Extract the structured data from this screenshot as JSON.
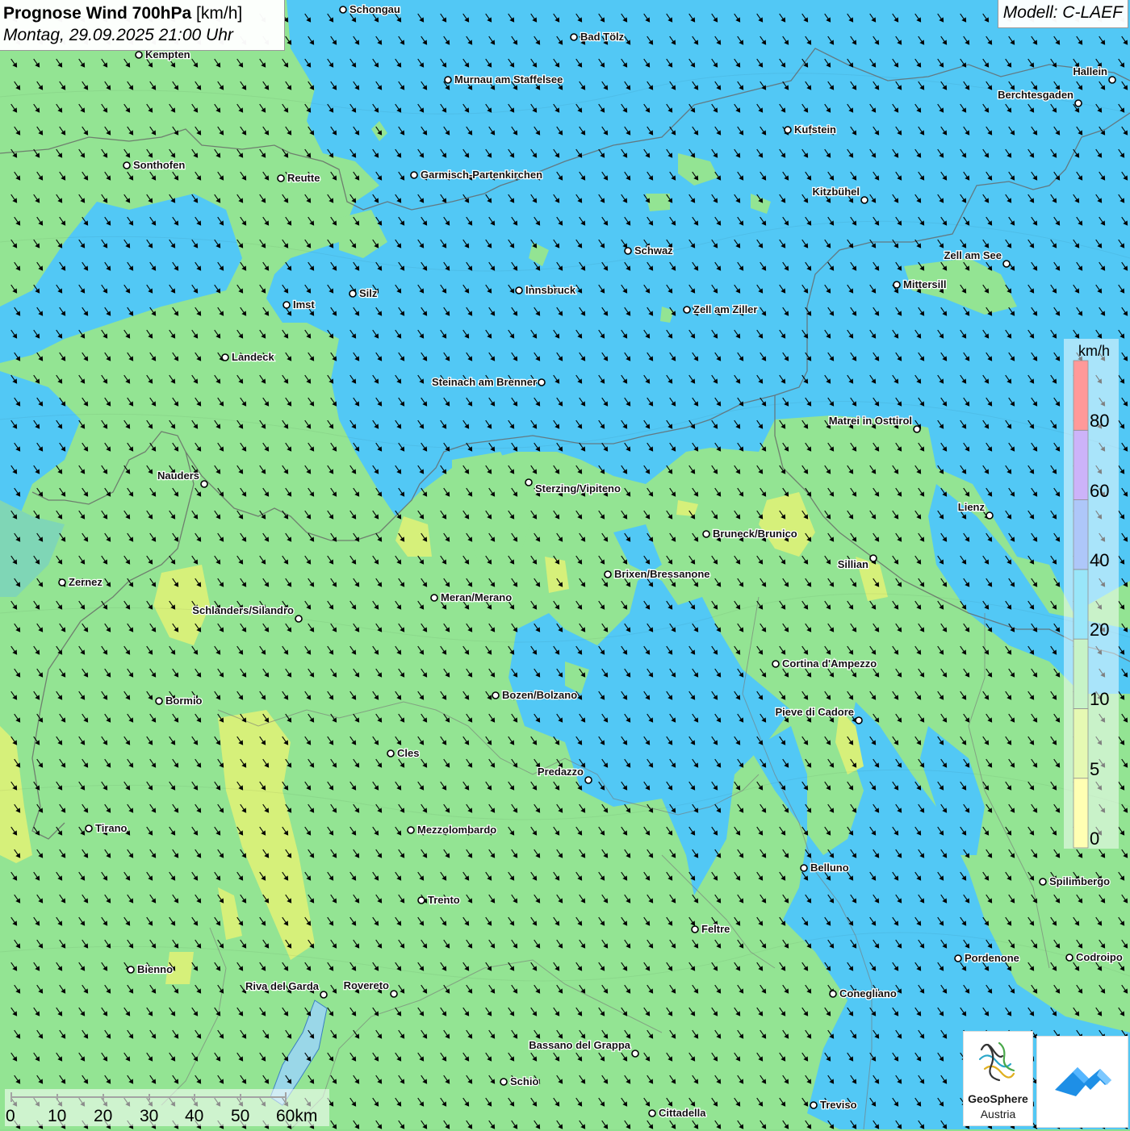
{
  "header": {
    "title_bold": "Prognose Wind 700hPa",
    "title_unit": "[km/h]",
    "datetime": "Montag, 29.09.2025 21:00 Uhr",
    "model": "Modell: C-LAEF"
  },
  "legend": {
    "unit": "km/h",
    "bins": [
      {
        "label": "0",
        "color": "#ffff66"
      },
      {
        "label": "5",
        "color": "#ccf266"
      },
      {
        "label": "10",
        "color": "#8fe68f"
      },
      {
        "label": "20",
        "color": "#33ccf2"
      },
      {
        "label": "40",
        "color": "#5c8ff2"
      },
      {
        "label": "60",
        "color": "#9966f2"
      },
      {
        "label": "80",
        "color": "#ff3333"
      }
    ]
  },
  "scale_bar": {
    "labels": [
      "0",
      "10",
      "20",
      "30",
      "40",
      "50",
      "60km"
    ]
  },
  "cities": [
    {
      "name": "Schongau"
    },
    {
      "name": "Kempten"
    },
    {
      "name": "Bad Tölz"
    },
    {
      "name": "Murnau am Staffelsee"
    },
    {
      "name": "Hallein"
    },
    {
      "name": "Berchtesgaden"
    },
    {
      "name": "Kufstein"
    },
    {
      "name": "Sonthofen"
    },
    {
      "name": "Reutte"
    },
    {
      "name": "Garmisch-Partenkirchen"
    },
    {
      "name": "Kitzbühel"
    },
    {
      "name": "Schwaz"
    },
    {
      "name": "Zell am See"
    },
    {
      "name": "Mittersill"
    },
    {
      "name": "Innsbruck"
    },
    {
      "name": "Silz"
    },
    {
      "name": "Imst"
    },
    {
      "name": "Zell am Ziller"
    },
    {
      "name": "Landeck"
    },
    {
      "name": "Steinach am Brenner"
    },
    {
      "name": "Matrei in Osttirol"
    },
    {
      "name": "Nauders"
    },
    {
      "name": "Sterzing/Vipiteno"
    },
    {
      "name": "Lienz"
    },
    {
      "name": "Bruneck/Brunico"
    },
    {
      "name": "Sillian"
    },
    {
      "name": "Zernez"
    },
    {
      "name": "Brixen/Bressanone"
    },
    {
      "name": "Meran/Merano"
    },
    {
      "name": "Schlanders/Silandro"
    },
    {
      "name": "Cortina d'Ampezzo"
    },
    {
      "name": "Bozen/Bolzano"
    },
    {
      "name": "Bormio"
    },
    {
      "name": "Pieve di Cadore"
    },
    {
      "name": "Cles"
    },
    {
      "name": "Predazzo"
    },
    {
      "name": "Tirano"
    },
    {
      "name": "Mezzolombardo"
    },
    {
      "name": "Belluno"
    },
    {
      "name": "Spilimbergo"
    },
    {
      "name": "Trento"
    },
    {
      "name": "Feltre"
    },
    {
      "name": "Pordenone"
    },
    {
      "name": "Codroipo"
    },
    {
      "name": "Bienno"
    },
    {
      "name": "Riva del Garda"
    },
    {
      "name": "Rovereto"
    },
    {
      "name": "Conegliano"
    },
    {
      "name": "Bassano del Grappa"
    },
    {
      "name": "Schio"
    },
    {
      "name": "Treviso"
    },
    {
      "name": "Cittadella"
    }
  ],
  "logos": {
    "geosphere_line1": "GeoSphere",
    "geosphere_line2": "Austria"
  },
  "colors": {
    "wind_lt5": "#ccf266",
    "wind_5_10": "#8fe68f",
    "wind_10_20": "#33ccf2",
    "arrow": "#000000",
    "border": "#555555"
  }
}
